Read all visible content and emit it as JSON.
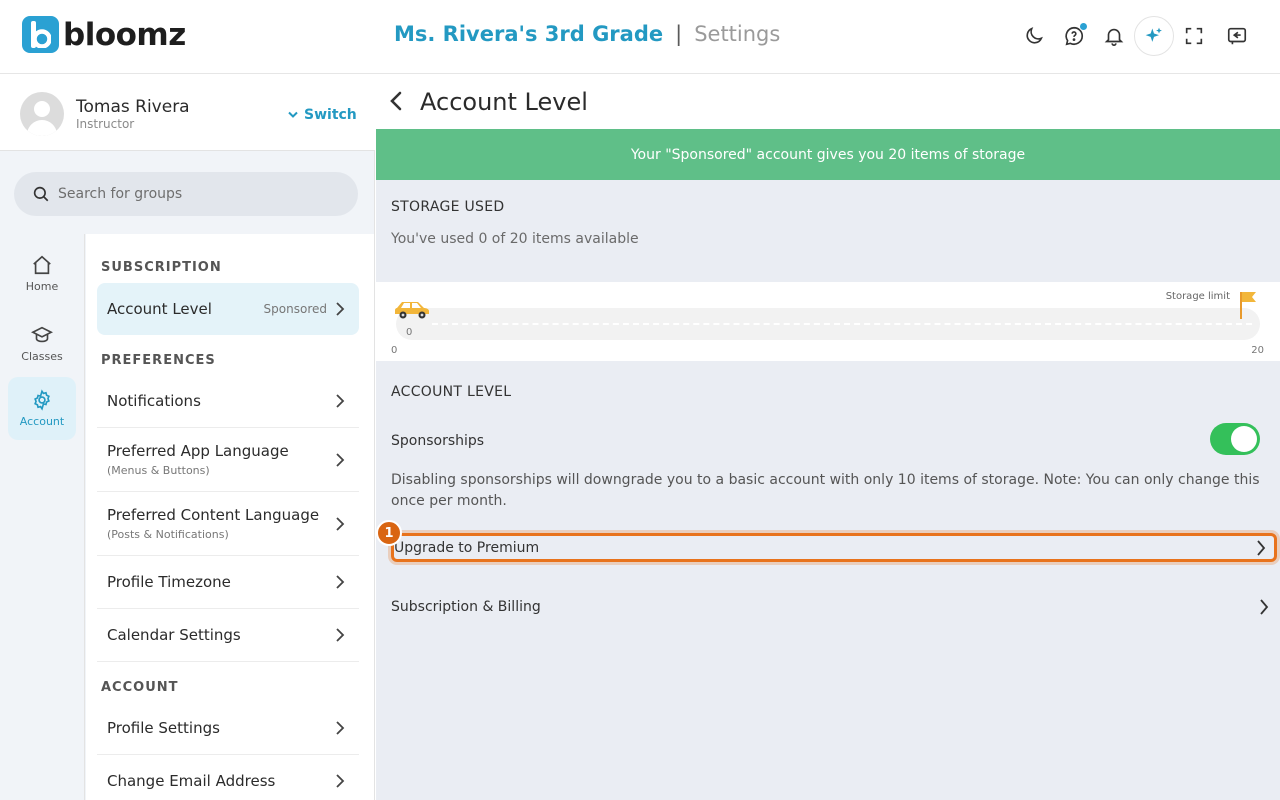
{
  "header": {
    "logo_text": "bloomz",
    "class_name": "Ms. Rivera's 3rd Grade",
    "separator": "|",
    "page_name": "Settings",
    "icons": [
      "moon-icon",
      "help-chat-icon",
      "bell-icon",
      "sparkle-icon",
      "fullscreen-icon",
      "collapse-panel-icon"
    ]
  },
  "profile": {
    "name": "Tomas Rivera",
    "role": "Instructor",
    "switch_label": "Switch"
  },
  "search": {
    "placeholder": "Search for groups"
  },
  "nav": {
    "items": [
      {
        "label": "Home",
        "icon": "home-icon"
      },
      {
        "label": "Classes",
        "icon": "graduation-cap-icon"
      },
      {
        "label": "Account",
        "icon": "gear-icon",
        "active": true
      }
    ]
  },
  "settings": {
    "subscription_title": "SUBSCRIPTION",
    "account_level_label": "Account Level",
    "account_level_badge": "Sponsored",
    "preferences_title": "PREFERENCES",
    "notifications": "Notifications",
    "app_language": "Preferred App Language",
    "app_language_sub": "(Menus & Buttons)",
    "content_language": "Preferred Content Language",
    "content_language_sub": "(Posts & Notifications)",
    "timezone": "Profile Timezone",
    "calendar": "Calendar Settings",
    "account_title": "ACCOUNT",
    "profile_settings": "Profile Settings",
    "change_email": "Change Email Address"
  },
  "main": {
    "title": "Account Level",
    "banner": "Your \"Sponsored\" account gives you 20 items of storage",
    "storage_title": "STORAGE USED",
    "storage_usage": "You've used 0 of 20 items available",
    "storage_used": 0,
    "storage_limit": 20,
    "track_current": "0",
    "scale_min": "0",
    "scale_max": "20",
    "limit_label": "Storage limit",
    "account_level_title": "ACCOUNT LEVEL",
    "sponsorships_label": "Sponsorships",
    "sponsorships_on": true,
    "description": "Disabling sponsorships will downgrade you to a basic account with only 10 items of storage. Note: You can only change this once per month.",
    "upgrade_label": "Upgrade to Premium",
    "billing_label": "Subscription & Billing",
    "step_number": "1"
  },
  "colors": {
    "accent": "#2399c2",
    "banner": "#5fbf88",
    "toggle_on": "#34c05a",
    "highlight": "#e8731c"
  }
}
